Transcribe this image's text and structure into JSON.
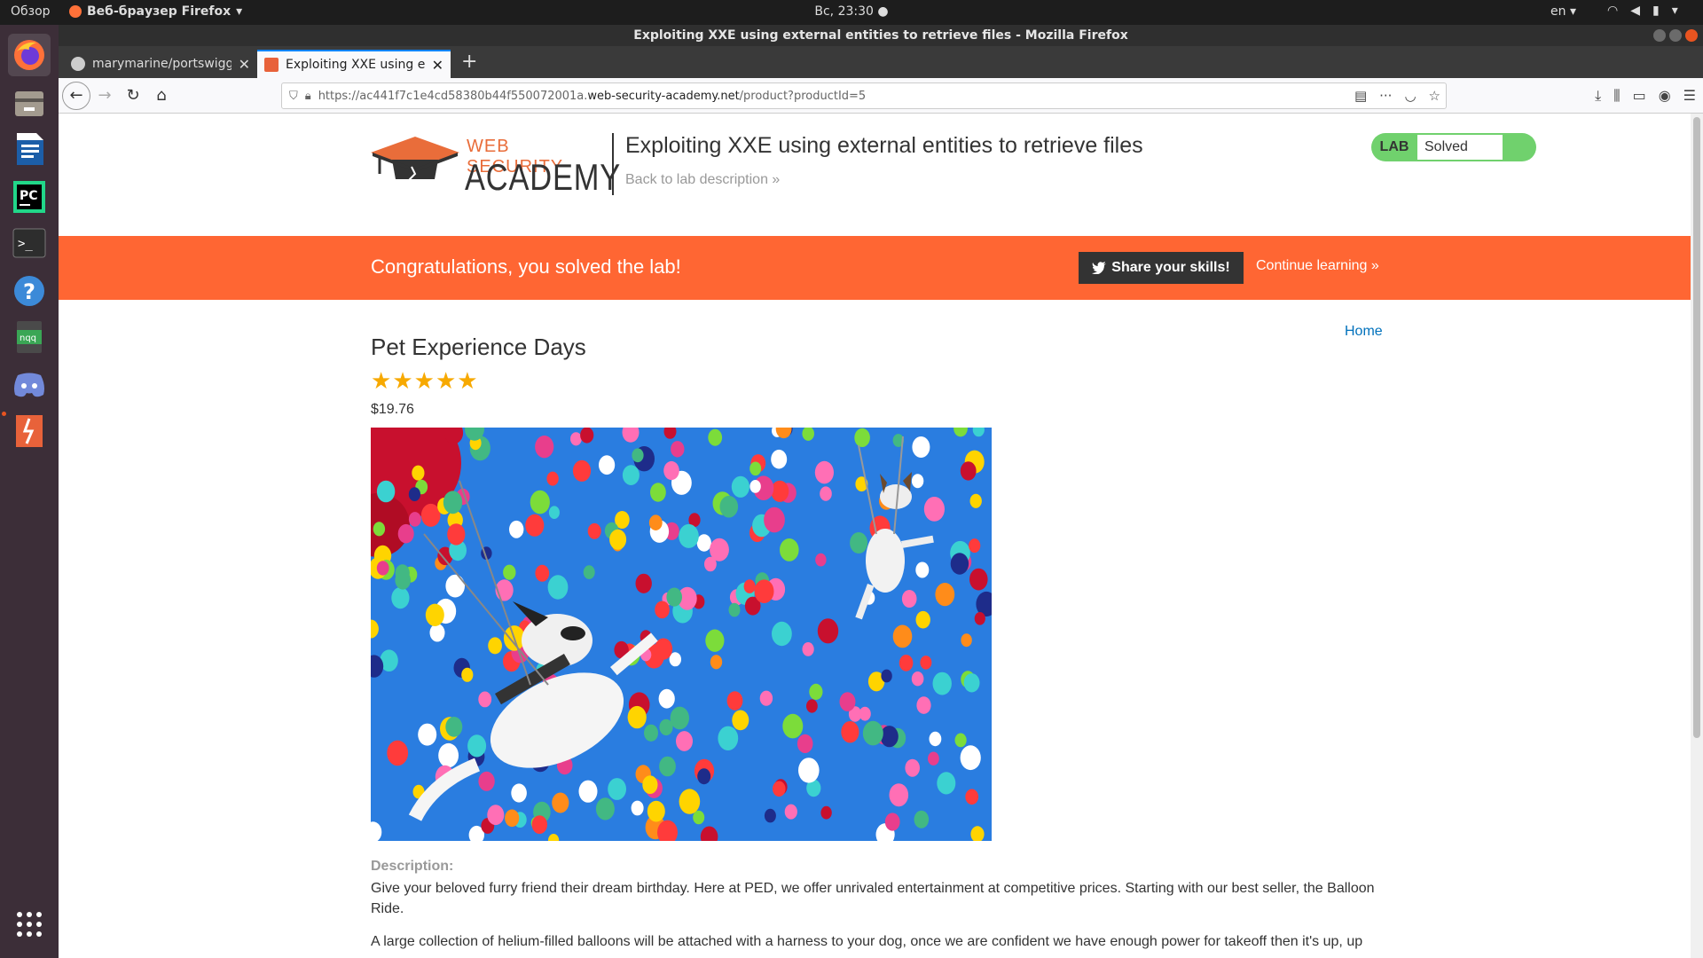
{
  "os": {
    "activities": "Обзор",
    "app_menu": "Веб-браузер Firefox",
    "clock": "Вс, 23:30",
    "lang": "en"
  },
  "window": {
    "title": "Exploiting XXE using external entities to retrieve files - Mozilla Firefox"
  },
  "tabs": [
    {
      "label": "marymarine/portswigger"
    },
    {
      "label": "Exploiting XXE using exte"
    }
  ],
  "urlbar": {
    "prefix": "https://ac441f7c1e4cd58380b44f550072001a.",
    "host": "web-security-academy.net",
    "path": "/product?productId=5"
  },
  "header": {
    "logo_line1": "WEB SECURITY",
    "logo_line2": "ACADEMY",
    "lab_title": "Exploiting XXE using external entities to retrieve files",
    "back_link": "Back to lab description »",
    "lab_badge": "LAB",
    "lab_status": "Solved"
  },
  "banner": {
    "message": "Congratulations, you solved the lab!",
    "share": "Share your skills!",
    "continue": "Continue learning »"
  },
  "product": {
    "home": "Home",
    "name": "Pet Experience Days",
    "rating": 5,
    "price": "$19.76",
    "desc_label": "Description:",
    "desc_p1": "Give your beloved furry friend their dream birthday. Here at PED, we offer unrivaled entertainment at competitive prices. Starting with our best seller, the Balloon Ride.",
    "desc_p2": "A large collection of helium-filled balloons will be attached with a harness to your dog, once we are confident we have enough power for takeoff then it's up, up"
  },
  "colors": {
    "banner": "#ff6633",
    "solved": "#70d16d",
    "link": "#0071bc",
    "star": "#f7a900"
  }
}
